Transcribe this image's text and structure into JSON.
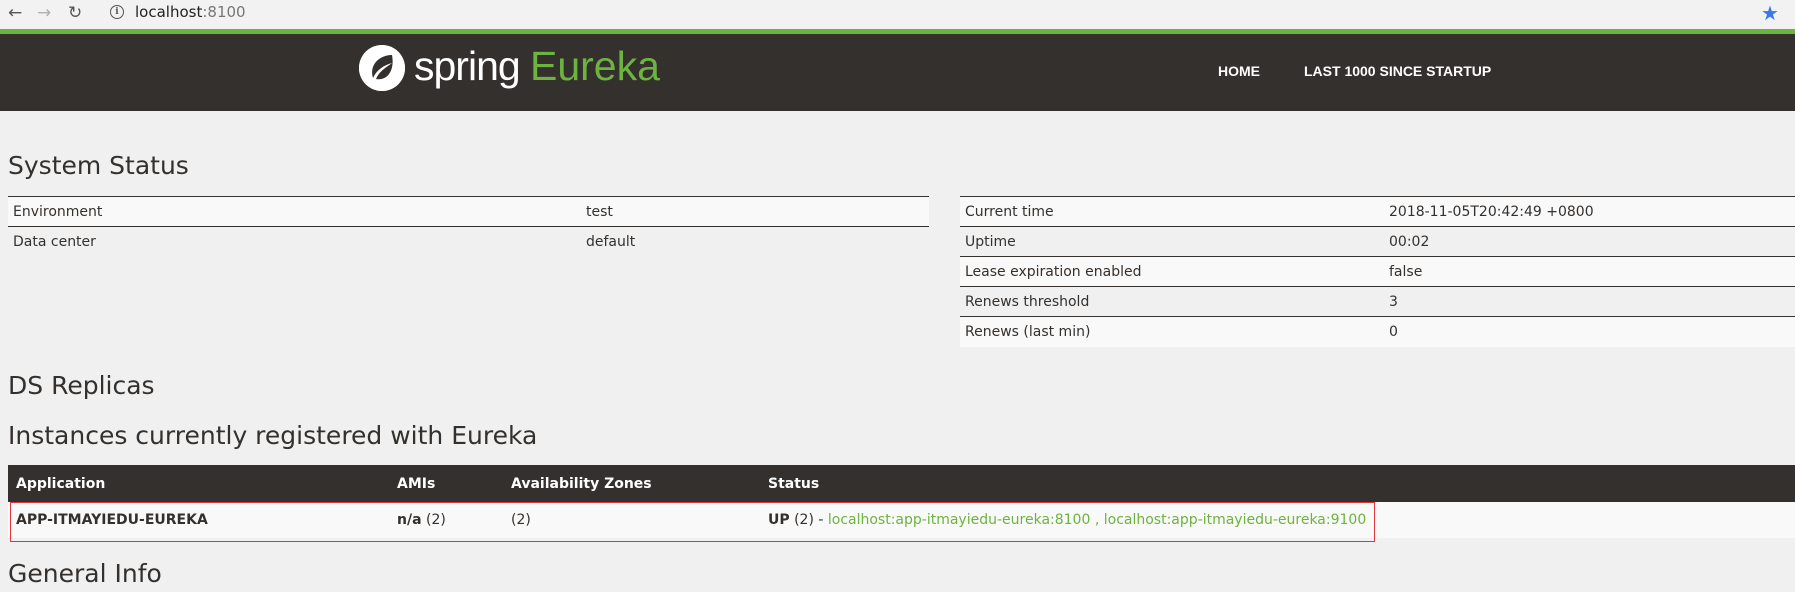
{
  "browser": {
    "url_host": "localhost",
    "url_port": ":8100",
    "info_glyph": "i"
  },
  "brand": {
    "spring": "spring",
    "eureka": "Eureka"
  },
  "nav": {
    "home": "HOME",
    "last1000": "LAST 1000 SINCE STARTUP"
  },
  "system_status": {
    "title": "System Status",
    "left": [
      {
        "label": "Environment",
        "value": "test"
      },
      {
        "label": "Data center",
        "value": "default"
      }
    ],
    "right": [
      {
        "label": "Current time",
        "value": "2018-11-05T20:42:49 +0800"
      },
      {
        "label": "Uptime",
        "value": "00:02"
      },
      {
        "label": "Lease expiration enabled",
        "value": "false"
      },
      {
        "label": "Renews threshold",
        "value": "3"
      },
      {
        "label": "Renews (last min)",
        "value": "0"
      }
    ]
  },
  "ds_replicas": {
    "title": "DS Replicas"
  },
  "instances": {
    "title": "Instances currently registered with Eureka",
    "headers": [
      "Application",
      "AMIs",
      "Availability Zones",
      "Status"
    ],
    "rows": [
      {
        "application": "APP-ITMAYIEDU-EUREKA",
        "amis_bold": "n/a",
        "amis_count": " (2)",
        "zones": "(2)",
        "status_bold": "UP",
        "status_count": " (2) - ",
        "link1": "localhost:app-itmayiedu-eureka:8100",
        "separator": " , ",
        "link2": "localhost:app-itmayiedu-eureka:9100"
      }
    ]
  },
  "general_info": {
    "title": "General Info"
  },
  "colors": {
    "brand_green": "#6db33f",
    "navbar_dark": "#34302d",
    "highlight_red": "#e0353a"
  }
}
